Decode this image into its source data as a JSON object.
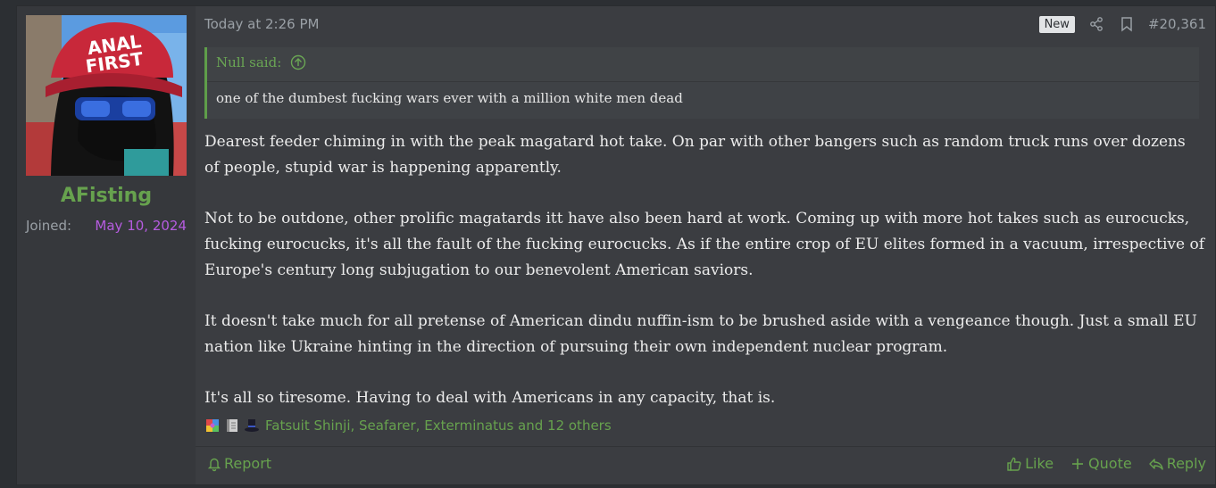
{
  "user": {
    "avatar_cap_text": "ANAL FIRST",
    "username": "AFisting",
    "joined_label": "Joined:",
    "joined_date": "May 10, 2024"
  },
  "post": {
    "date": "Today at 2:26 PM",
    "badge": "New",
    "number": "#20,361",
    "quote": {
      "author": "Null said:",
      "text": "one of the dumbest fucking wars ever with a million white men dead"
    },
    "paragraphs": [
      "Dearest feeder chiming in with the peak magatard hot take. On par with other bangers such as random truck runs over dozens of people, stupid war is happening apparently.",
      "Not to be outdone, other prolific magatards itt have also been hard at work. Coming up with more hot takes such as eurocucks, fucking eurocucks, it's all the fault of the fucking eurocucks. As if the entire crop of EU elites formed in a vacuum, irrespective of Europe's century long subjugation to our benevolent American saviors.",
      "It doesn't take much for all pretense of American dindu nuffin-ism to be brushed aside with a vengeance though. Just a small EU nation like Ukraine hinting in the direction of pursuing their own independent nuclear program.",
      "It's all so tiresome. Having to deal with Americans in any capacity, that is."
    ],
    "reactions": {
      "icons": [
        "puzzle-reaction-icon",
        "book-reaction-icon",
        "top-hat-reaction-icon"
      ],
      "text": "Fatsuit Shinji, Seafarer, Exterminatus and 12 others"
    }
  },
  "footer": {
    "report": "Report",
    "like": "Like",
    "quote": "Quote",
    "reply": "Reply"
  },
  "colors": {
    "accent_green": "#67a24e",
    "joined_purple": "#b65ce0",
    "background": "#3b3d41"
  }
}
